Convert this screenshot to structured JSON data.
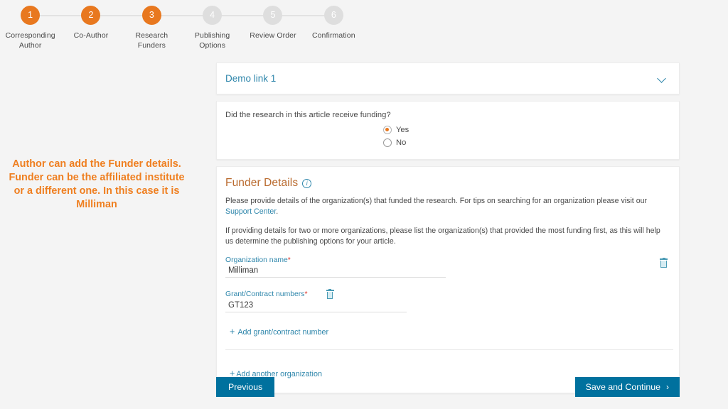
{
  "stepper": {
    "steps": [
      {
        "number": "1",
        "label": "Corresponding Author",
        "state": "active"
      },
      {
        "number": "2",
        "label": "Co-Author",
        "state": "active"
      },
      {
        "number": "3",
        "label": "Research Funders",
        "state": "active"
      },
      {
        "number": "4",
        "label": "Publishing Options",
        "state": "inactive"
      },
      {
        "number": "5",
        "label": "Review Order",
        "state": "inactive"
      },
      {
        "number": "6",
        "label": "Confirmation",
        "state": "inactive"
      }
    ],
    "active_color": "#e8781f",
    "inactive_color": "#dedede"
  },
  "annotation": {
    "text": "Author can add the Funder details. Funder can be the affiliated institute or a different one. In this case it is Milliman",
    "color": "#ef7f20"
  },
  "demo_link_card": {
    "title": "Demo link 1",
    "chevron": "chevron-down-icon",
    "title_color": "#2e86ab"
  },
  "funding_question": {
    "question": "Did the research in this article receive funding?",
    "options": [
      {
        "label": "Yes",
        "selected": true
      },
      {
        "label": "No",
        "selected": false
      }
    ],
    "selected_color": "#e8781f"
  },
  "funder_details": {
    "heading": "Funder Details",
    "info_icon": "info-icon",
    "heading_color": "#b96a2e",
    "paragraph_1_before_link": "Please provide details of the organization(s) that funded the research. For tips on searching for an organization please visit our ",
    "paragraph_1_link": "Support Center",
    "paragraph_1_after_link": ".",
    "paragraph_2": "If providing details for two or more organizations, please list the organization(s) that provided the most funding first, as this will help us determine the publishing options for your article.",
    "organization_field": {
      "label": "Organization name",
      "required_marker": "*",
      "value": "Milliman",
      "delete_icon": "trash-icon"
    },
    "grant_field": {
      "label": "Grant/Contract numbers",
      "required_marker": "*",
      "value": "GT123",
      "delete_icon": "trash-icon"
    },
    "add_grant_link": "Add grant/contract number",
    "add_organization_link": "Add another organization",
    "plus_symbol": "+",
    "link_color": "#2e86ab"
  },
  "footer": {
    "previous_label": "Previous",
    "save_continue_label": "Save and Continue",
    "save_continue_arrow": "›",
    "button_color": "#00719e"
  }
}
